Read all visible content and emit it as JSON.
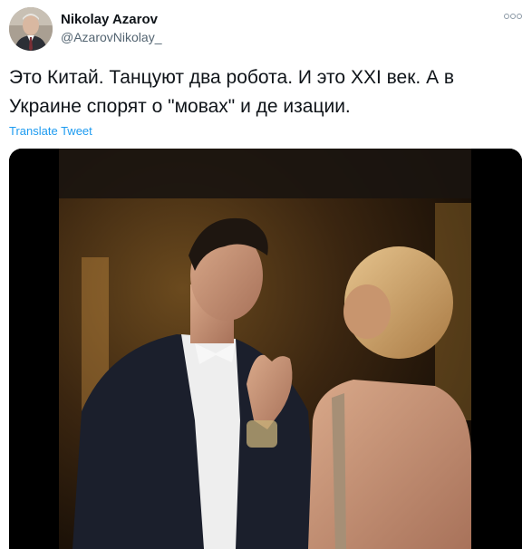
{
  "author": {
    "name": "Nikolay Azarov",
    "handle": "@AzarovNikolay_"
  },
  "tweet": {
    "text": "Это Китай. Танцуют два робота. И это XXI век. А в Украине спорят о \"мовах\" и де        изации.",
    "translate_label": "Translate Tweet"
  },
  "media": {
    "kind": "video",
    "description_icon": "video-still"
  },
  "colors": {
    "link": "#1d9bf0",
    "text": "#0f1419",
    "secondary": "#536471"
  }
}
